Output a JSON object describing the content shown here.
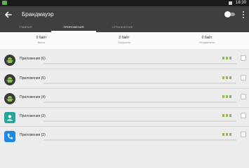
{
  "status_bar": {
    "time": "18:30"
  },
  "app_bar": {
    "title": "Брандмауэр",
    "firewall_enabled": false
  },
  "tabs": [
    {
      "label": "ГЛАВНАЯ",
      "active": false
    },
    {
      "label": "ПРИЛОЖЕНИЯ",
      "active": true
    },
    {
      "label": "ОГРАНИЧЕНИЕ",
      "active": false
    }
  ],
  "summary": [
    {
      "value": "0 байт",
      "label": "Всего"
    },
    {
      "value": "0 байт",
      "label": "Получено"
    },
    {
      "value": "0 байт",
      "label": "Отправлено"
    }
  ],
  "apps": [
    {
      "label": "Приложения (6)",
      "icon": "android-icon",
      "icon_color": "#7cb342"
    },
    {
      "label": "Приложения (5)",
      "icon": "android-icon",
      "icon_color": "#7cb342"
    },
    {
      "label": "Приложения (4)",
      "icon": "android-icon",
      "icon_color": "#7cb342"
    },
    {
      "label": "Приложения (3)",
      "icon": "contacts-icon",
      "icon_color": "#26a69a"
    },
    {
      "label": "Приложения (2)",
      "icon": "phone-icon",
      "icon_color": "#1e88e5"
    }
  ],
  "colors": {
    "app_bar": "#404040",
    "status_bar": "#1b1b1b",
    "background": "#ececec",
    "accent": "#8bc34a"
  }
}
